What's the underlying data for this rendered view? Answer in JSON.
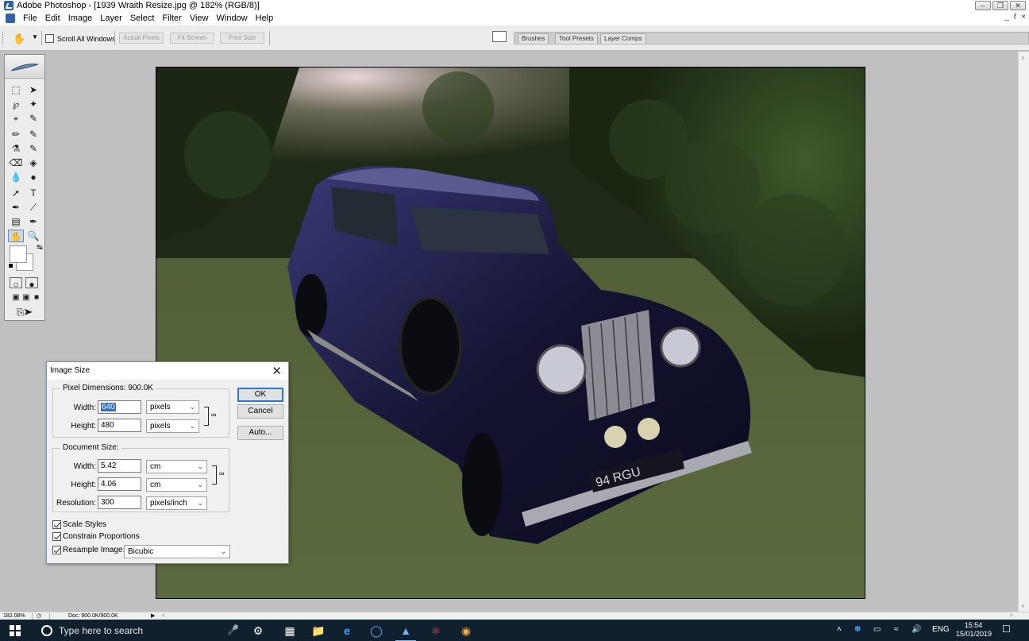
{
  "window": {
    "title": "Adobe Photoshop - [1939 Wraith Resize.jpg @ 182% (RGB/8)]",
    "controls": [
      "minimize",
      "restore",
      "close"
    ]
  },
  "menu": {
    "items": [
      "File",
      "Edit",
      "Image",
      "Layer",
      "Select",
      "Filter",
      "View",
      "Window",
      "Help"
    ],
    "doc_controls": [
      "_",
      "ř",
      "×"
    ]
  },
  "options_bar": {
    "scroll_all_windows": {
      "label": "Scroll All Windows",
      "checked": false
    },
    "buttons": [
      "Actual Pixels",
      "Fit Screen",
      "Print Size"
    ]
  },
  "palette_well": {
    "tabs": [
      "Brushes",
      "Tool Presets",
      "Layer Comps"
    ]
  },
  "image_size_dialog": {
    "title": "Image Size",
    "close_glyph": "✕",
    "pixel_dimensions": {
      "label": "Pixel Dimensions:  900.0K",
      "width_label": "Width:",
      "width_value": "640",
      "width_unit": "pixels",
      "height_label": "Height:",
      "height_value": "480",
      "height_unit": "pixels"
    },
    "document_size": {
      "label": "Document Size:",
      "width_label": "Width:",
      "width_value": "5.42",
      "width_unit": "cm",
      "height_label": "Height:",
      "height_value": "4.06",
      "height_unit": "cm",
      "resolution_label": "Resolution:",
      "resolution_value": "300",
      "resolution_unit": "pixels/inch"
    },
    "scale_styles": {
      "label": "Scale Styles",
      "checked": true
    },
    "constrain_proportions": {
      "label": "Constrain Proportions",
      "checked": true
    },
    "resample_image": {
      "label": "Resample Image:",
      "checked": true,
      "method": "Bicubic"
    },
    "buttons": {
      "ok": "OK",
      "cancel": "Cancel",
      "auto": "Auto..."
    }
  },
  "status_bar": {
    "zoom": "182.08%",
    "doc_info": "Doc: 900.0K/900.0K"
  },
  "taskbar": {
    "search_placeholder": "Type here to search",
    "apps": [
      "settings-icon",
      "calculator-icon",
      "file-explorer-icon",
      "edge-icon",
      "browser-icon",
      "photoshop-icon",
      "acrobat-icon",
      "chrome-icon"
    ],
    "language": "ENG",
    "time": "15:54",
    "date": "15/01/2019"
  },
  "colors": {
    "taskbar_bg": "#10202e",
    "selection": "#3070d0",
    "default_button_border": "#2a78d6",
    "canvas_bg": "#c0c0c0"
  }
}
